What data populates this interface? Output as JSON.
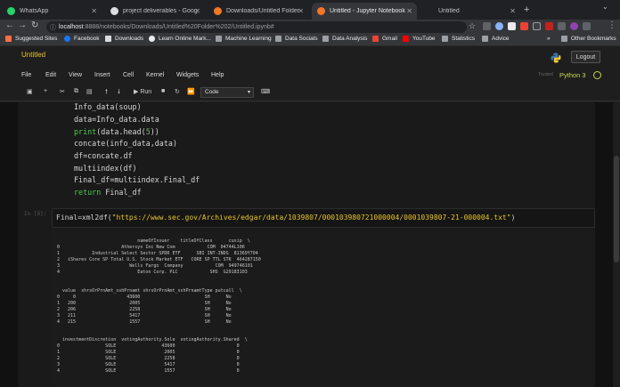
{
  "browser": {
    "tabs": [
      {
        "label": "WhatsApp",
        "active": false
      },
      {
        "label": "project deliverables - Google Docs",
        "active": false
      },
      {
        "label": "Downloads/Untitled Folder 2/",
        "active": false
      },
      {
        "label": "Untitled - Jupyter Notebook",
        "active": true
      },
      {
        "label": "Untitled",
        "active": false
      }
    ],
    "url_host": "localhost",
    "url_rest": ":8888/notebooks/Downloads/Untitled%20Folder%202/Untitled.ipynb#",
    "bookmarks": [
      "Suggested Sites",
      "Facebook",
      "Downloads",
      "Learn Online Mark...",
      "Machine Learning",
      "Data Socials",
      "Data Analysis",
      "Gmail",
      "YouTube",
      "Statistics",
      "Advice",
      "Other Bookmarks"
    ]
  },
  "jupyter": {
    "notebook_name": "Untitled",
    "logout_label": "Logout",
    "menu": [
      "File",
      "Edit",
      "View",
      "Insert",
      "Cell",
      "Kernel",
      "Widgets",
      "Help"
    ],
    "trusted_label": "Trusted",
    "kernel_name": "Python 3",
    "run_label": "Run",
    "cell_type": "Code"
  },
  "cell1": {
    "lines": [
      "Info_data(soup)",
      "data=Info_data.data",
      "print(data.head(5))",
      "concate(info_data,data)",
      "df=concate.df",
      "multiindex(df)",
      "Final_df=multiindex.Final_df",
      "return Final_df"
    ]
  },
  "cell2": {
    "prompt": "In [8]:",
    "code_prefix": "Final=xml2df(",
    "code_string": "\"https://www.sec.gov/Archives/edgar/data/1039807/000103980721000004/0001039807-21-000004.txt\"",
    "code_suffix": ")"
  },
  "output": {
    "lines": [
      "                              nameOfIssuer    titleOfClass      cusip  \\",
      "0                       Athersys Inc New Com            COM  04744L106",
      "1            Industrial Select Sector SPDR ETF      SBI INT-INDS  81369Y704",
      "2   iShares Core SP Total U.S. Stock Market ETF   CORE SP TTL STK  464287150",
      "3                          Wells Fargo  Company            COM  949746101",
      "4                             Eaton Corp. PLC            SHS  G29183103",
      "",
      "  value  shrsOrPrnAmt_sshPrnamt shrsOrPrnAmt_sshPrnamtType putcall  \\",
      "0     0                   43600                        SH      No",
      "1   200                    2005                        SH      No",
      "2   206                    2258                        SH      No",
      "3   211                    5417                        SH      No",
      "4   215                    1557                        SH      No",
      "",
      "  investmentDiscretion  votingAuthority.Sole  votingAuthority.Shared  \\",
      "0                 SOLE                 43600                       0",
      "1                 SOLE                  2005                       0",
      "2                 SOLE                  2258                       0",
      "3                 SOLE                  5417                       0",
      "4                 SOLE                  1557                       0"
    ]
  }
}
